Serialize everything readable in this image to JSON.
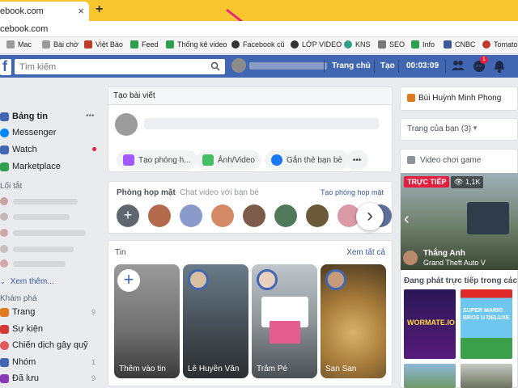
{
  "browser": {
    "tab_title": "ebook.com",
    "new_tab_label": "+",
    "close_label": "×",
    "url": "cebook.com",
    "bookmarks": [
      {
        "label": "Mac",
        "color": "#8e8e8e"
      },
      {
        "label": "Bài chờ",
        "color": "#8e8e8e"
      },
      {
        "label": "Việt Báo",
        "color": "#c0392b"
      },
      {
        "label": "Feed",
        "color": "#2e9e4f"
      },
      {
        "label": "Thống kê video",
        "color": "#2e9e4f"
      },
      {
        "label": "Facebook cũ",
        "color": "#333333"
      },
      {
        "label": "LỚP VIDEO",
        "color": "#333333"
      },
      {
        "label": "KNS",
        "color": "#2e9e8f"
      },
      {
        "label": "SEO",
        "color": "#555555"
      },
      {
        "label": "Info",
        "color": "#2e9e4f"
      },
      {
        "label": "CNBC",
        "color": "#3b5998"
      },
      {
        "label": "TomatoT",
        "color": "#c0392b"
      }
    ]
  },
  "fb_header": {
    "logo": "f",
    "search_placeholder": "Tìm kiếm",
    "home_label": "Trang chủ",
    "create_label": "Tạo",
    "time": "00:03:09",
    "msg_badge": "1",
    "accent": "#4267b2"
  },
  "left_nav": {
    "items": [
      {
        "label": "Bảng tin",
        "color": "#4267b2"
      },
      {
        "label": "Messenger",
        "color": "#0084ff"
      },
      {
        "label": "Watch",
        "color": "#4267b2"
      },
      {
        "label": "Marketplace",
        "color": "#2e9e4f"
      }
    ],
    "more_dots": "•••",
    "shortcuts_title": "Lối tắt",
    "see_more": "Xem thêm...",
    "explore_title": "Khám phá",
    "explore": [
      {
        "label": "Trang",
        "count": "9",
        "color": "#e07a1f"
      },
      {
        "label": "Sự kiện",
        "count": "",
        "color": "#d63838"
      },
      {
        "label": "Chiến dịch gây quỹ",
        "count": "",
        "color": "#e05b5b"
      },
      {
        "label": "Nhóm",
        "count": "1",
        "color": "#4267b2"
      },
      {
        "label": "Đã lưu",
        "count": "9",
        "color": "#8a3ab9"
      }
    ]
  },
  "composer": {
    "title": "Tạo bài viết",
    "btn_room": "Tạo phòng h...",
    "btn_photo": "Ảnh/Video",
    "btn_tag": "Gắn thẻ bạn bè",
    "btn_more": "•••"
  },
  "rooms": {
    "title": "Phòng họp mặt",
    "subtitle": "· Chat video với bạn bè",
    "create_link": "Tạo phòng họp mặt",
    "plus": "+",
    "next": "›"
  },
  "stories": {
    "title": "Tin",
    "see_all": "Xem tất cả",
    "add_label": "Thêm vào tin",
    "plus": "+",
    "items": [
      {
        "name": "Lê Huyền Vân"
      },
      {
        "name": "Trâm Pé"
      },
      {
        "name": "San San"
      }
    ]
  },
  "right": {
    "page_name": "Bùi Huỳnh Minh Phong",
    "your_pages": "Trang của bạn (3)",
    "video_game_title": "Video chơi game",
    "live_badge": "TRỰC TIẾP",
    "viewers": "1,1K",
    "streamer": "Thắng Anh",
    "game": "Grand Theft Auto V",
    "now_live": "Đang phát trực tiếp trong các trò",
    "game1": "WORMATE.IO",
    "game2": "SUPER MARIO BROS U DELUXE"
  }
}
